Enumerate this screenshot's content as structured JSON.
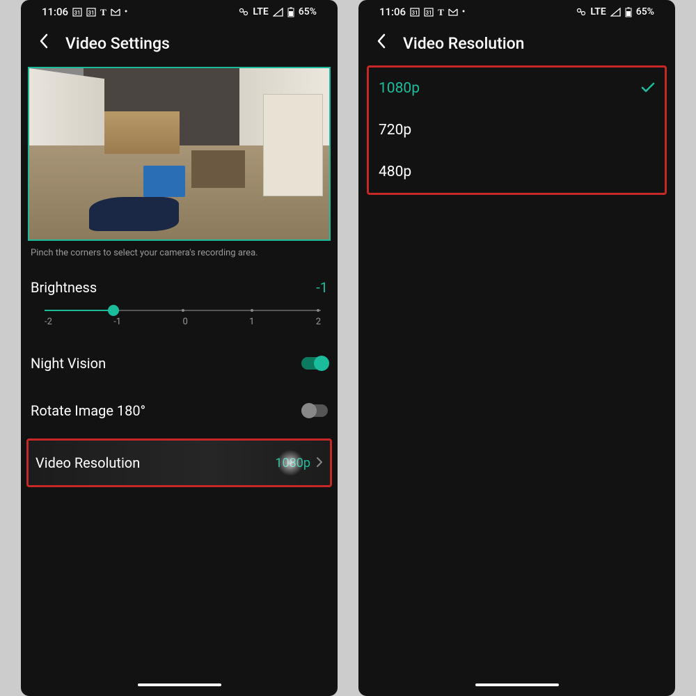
{
  "status": {
    "time": "11:06",
    "network_label": "LTE",
    "battery": "65%"
  },
  "left": {
    "title": "Video Settings",
    "preview_hint": "Pinch the corners to select your camera's recording area.",
    "brightness": {
      "label": "Brightness",
      "value": "-1",
      "ticks": [
        "-2",
        "-1",
        "0",
        "1",
        "2"
      ]
    },
    "night_vision": {
      "label": "Night Vision",
      "on": true
    },
    "rotate": {
      "label": "Rotate Image 180°",
      "on": false
    },
    "resolution_row": {
      "label": "Video Resolution",
      "value": "1080p"
    }
  },
  "right": {
    "title": "Video Resolution",
    "options": [
      {
        "label": "1080p",
        "selected": true
      },
      {
        "label": "720p",
        "selected": false
      },
      {
        "label": "480p",
        "selected": false
      }
    ]
  }
}
